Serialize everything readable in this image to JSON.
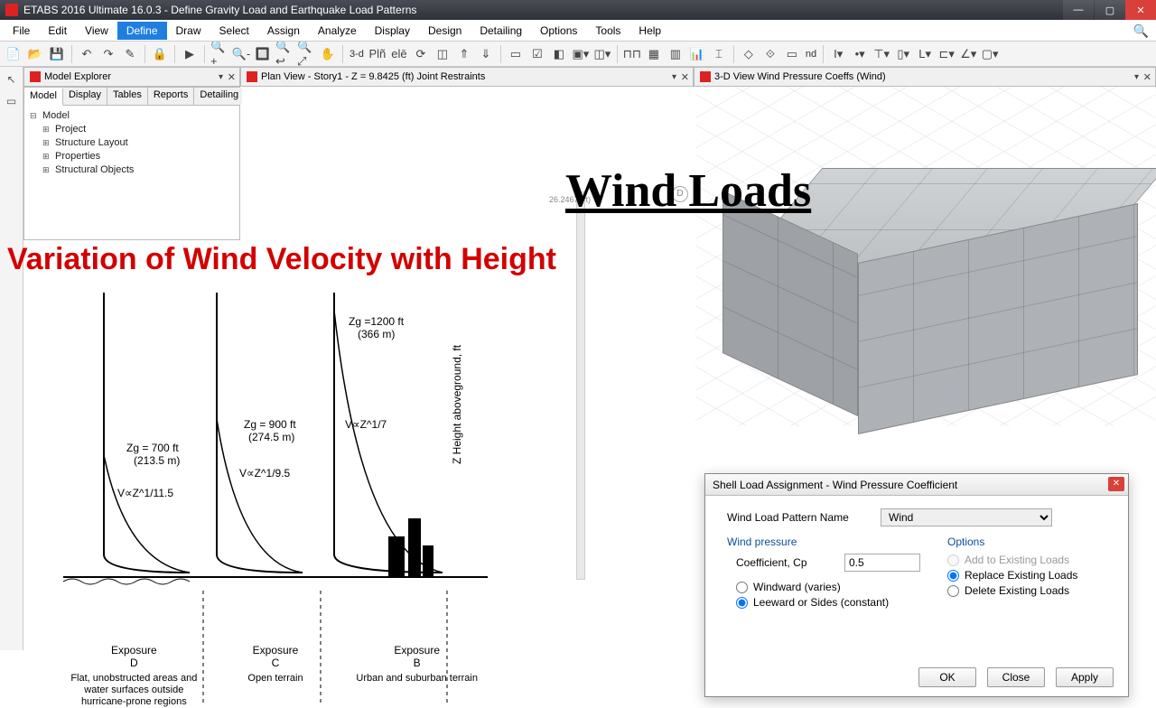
{
  "titlebar": {
    "text": "ETABS 2016 Ultimate 16.0.3 - Define Gravity Load and Earthquake Load Patterns"
  },
  "menu": [
    "File",
    "Edit",
    "View",
    "Define",
    "Draw",
    "Select",
    "Assign",
    "Analyze",
    "Display",
    "Design",
    "Detailing",
    "Options",
    "Tools",
    "Help"
  ],
  "menu_open_index": 3,
  "toolbar3d": "3-d",
  "toolbar_nd": "nd",
  "panels": {
    "model_explorer": "Model Explorer",
    "plan": "Plan View - Story1 - Z = 9.8425 (ft)  Joint Restraints",
    "view3d": "3-D View  Wind Pressure Coeffs (Wind)"
  },
  "mex_tabs": [
    "Model",
    "Display",
    "Tables",
    "Reports",
    "Detailing"
  ],
  "tree": {
    "root": "Model",
    "children": [
      "Project",
      "Structure Layout",
      "Properties",
      "Structural Objects"
    ]
  },
  "plan": {
    "dim_label": "26.2467 (ft)",
    "bubble": "D"
  },
  "big_title": "Wind Loads",
  "red_title": "Variation of Wind Velocity with Height",
  "diagram": {
    "ylabel": "Z Height aboveground, ft",
    "zg_d": "Z_g = 700 ft\n(213.5 m)",
    "zg_c": "Z_g = 900 ft\n(274.5 m)",
    "zg_b": "Z_g =1200 ft\n(366 m)",
    "eq_d": "V∝Z^(1/11.5)",
    "eq_c": "V∝Z^(1/9.5)",
    "eq_b": "V∝Z^(1/7)",
    "cols": [
      {
        "name": "Exposure\nD",
        "desc": "Flat, unobstructed areas and water surfaces outside hurricane-prone regions"
      },
      {
        "name": "Exposure\nC",
        "desc": "Open terrain"
      },
      {
        "name": "Exposure\nB",
        "desc": "Urban and suburban terrain"
      }
    ]
  },
  "dialog": {
    "title": "Shell Load Assignment - Wind Pressure Coefficient",
    "pattern_label": "Wind Load Pattern Name",
    "pattern_value": "Wind",
    "group_pressure": "Wind pressure",
    "coef_label": "Coefficient, Cp",
    "coef_value": "0.5",
    "radios_pressure": [
      {
        "label": "Windward (varies)",
        "checked": false
      },
      {
        "label": "Leeward or Sides (constant)",
        "checked": true
      }
    ],
    "group_options": "Options",
    "radios_options": [
      {
        "label": "Add to Existing Loads",
        "checked": false,
        "disabled": true
      },
      {
        "label": "Replace Existing Loads",
        "checked": true,
        "disabled": false
      },
      {
        "label": "Delete Existing Loads",
        "checked": false,
        "disabled": false
      }
    ],
    "buttons": {
      "ok": "OK",
      "close": "Close",
      "apply": "Apply"
    }
  }
}
